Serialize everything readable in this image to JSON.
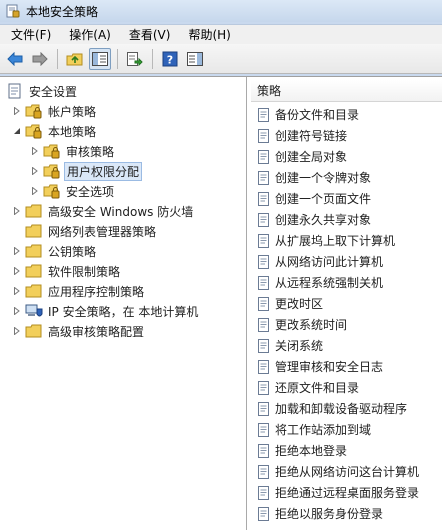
{
  "window": {
    "title": "本地安全策略"
  },
  "menu": [
    "文件(F)",
    "操作(A)",
    "查看(V)",
    "帮助(H)"
  ],
  "tree": [
    {
      "label": "安全设置",
      "indent": 0,
      "expander": "none",
      "icon": "shield-doc-icon"
    },
    {
      "label": "帐户策略",
      "indent": 1,
      "expander": "collapsed",
      "icon": "folder-lock-icon"
    },
    {
      "label": "本地策略",
      "indent": 1,
      "expander": "expanded",
      "icon": "folder-lock-icon"
    },
    {
      "label": "审核策略",
      "indent": 2,
      "expander": "collapsed",
      "icon": "folder-lock-icon"
    },
    {
      "label": "用户权限分配",
      "indent": 2,
      "expander": "collapsed",
      "icon": "folder-lock-icon",
      "selected": true
    },
    {
      "label": "安全选项",
      "indent": 2,
      "expander": "collapsed",
      "icon": "folder-lock-icon"
    },
    {
      "label": "高级安全 Windows 防火墙",
      "indent": 1,
      "expander": "collapsed",
      "icon": "folder-icon"
    },
    {
      "label": "网络列表管理器策略",
      "indent": 1,
      "expander": "none",
      "icon": "folder-icon"
    },
    {
      "label": "公钥策略",
      "indent": 1,
      "expander": "collapsed",
      "icon": "folder-icon"
    },
    {
      "label": "软件限制策略",
      "indent": 1,
      "expander": "collapsed",
      "icon": "folder-icon"
    },
    {
      "label": "应用程序控制策略",
      "indent": 1,
      "expander": "collapsed",
      "icon": "folder-icon"
    },
    {
      "label": "IP 安全策略，在 本地计算机",
      "indent": 1,
      "expander": "collapsed",
      "icon": "ip-security-icon"
    },
    {
      "label": "高级审核策略配置",
      "indent": 1,
      "expander": "collapsed",
      "icon": "folder-icon"
    }
  ],
  "list": {
    "header": "策略",
    "items": [
      "备份文件和目录",
      "创建符号链接",
      "创建全局对象",
      "创建一个令牌对象",
      "创建一个页面文件",
      "创建永久共享对象",
      "从扩展坞上取下计算机",
      "从网络访问此计算机",
      "从远程系统强制关机",
      "更改时区",
      "更改系统时间",
      "关闭系统",
      "管理审核和安全日志",
      "还原文件和目录",
      "加载和卸载设备驱动程序",
      "将工作站添加到域",
      "拒绝本地登录",
      "拒绝从网络访问这台计算机",
      "拒绝通过远程桌面服务登录",
      "拒绝以服务身份登录"
    ]
  },
  "toolbar": [
    "back-arrow-icon",
    "forward-arrow-icon",
    "up-folder-icon",
    "show-hide-tree-icon",
    "export-list-icon",
    "help-icon",
    "properties-panel-icon"
  ]
}
